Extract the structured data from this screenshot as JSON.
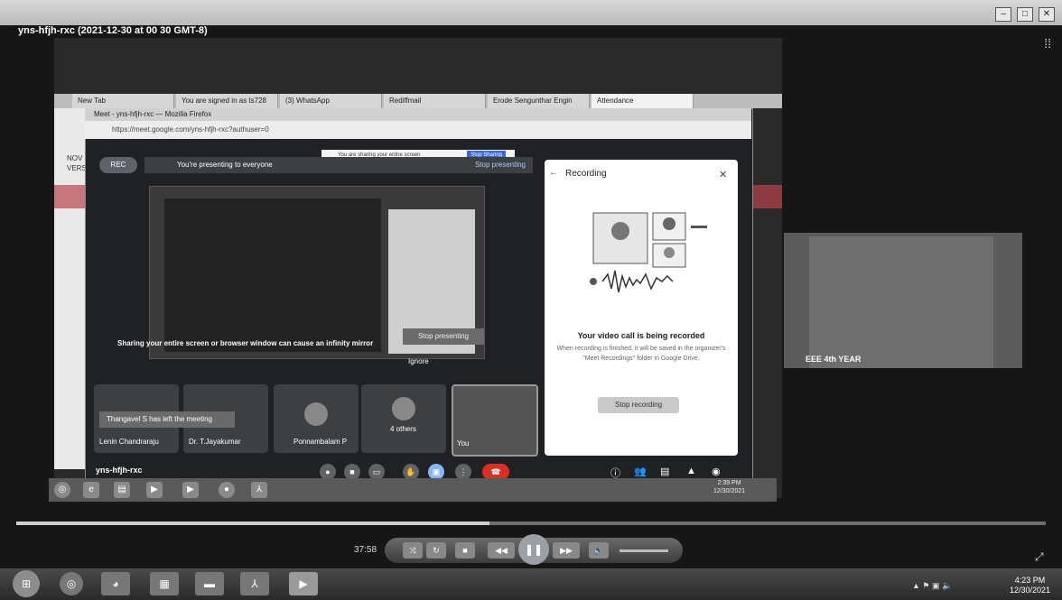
{
  "player": {
    "video_title": "yns-hfjh-rxc (2021-12-30 at 00 30 GMT-8)",
    "elapsed": "37:58",
    "progress_fraction": 0.46
  },
  "browser": {
    "tabs": [
      "New Tab",
      "You are signed in as ts728",
      "(3) WhatsApp",
      "Rediffmail",
      "Erode Sengunthar Engin",
      "Attendance"
    ],
    "window_title": "Meet - yns-hfjh-rxc — Mozilla Firefox",
    "url": "https://meet.google.com/yns-hfjh-rxc?authuser=0",
    "left_strip_text": "NOV VERS"
  },
  "share_bar": {
    "text": "You are sharing your entire screen",
    "button": "Stop Sharing"
  },
  "meet": {
    "rec_label": "REC",
    "presenting_text": "You're presenting to everyone",
    "stop_presenting": "Stop presenting",
    "inner_stop_presenting": "Stop presenting",
    "mirror_warning": "Sharing your entire screen or browser window can cause an infinity mirror",
    "ignore": "Ignore",
    "left_meeting_toast": "Thangavel S has left the meeting",
    "participants": [
      "Lenin Chandraraju",
      "Dr. T.Jayakumar",
      "Ponnambalam P",
      "4 others",
      "You"
    ],
    "meeting_code": "yns-hfjh-rxc"
  },
  "recording_panel": {
    "title": "Recording",
    "headline": "Your video call is being recorded",
    "description": "When recording is finished, it will be saved in the organizer's \"Meet Recordings\" folder in Google Drive.",
    "stop_button": "Stop recording"
  },
  "inner_clock": {
    "time": "2:39 PM",
    "date": "12/30/2021"
  },
  "webcam": {
    "label": "EEE 4th YEAR"
  },
  "taskbar_clock": {
    "time": "4:23 PM",
    "date": "12/30/2021"
  },
  "icons": [
    "close-icon",
    "back-arrow-icon",
    "mic-icon",
    "camera-icon",
    "captions-icon",
    "hand-icon",
    "present-icon",
    "more-icon",
    "hangup-icon",
    "info-icon",
    "people-icon",
    "chat-icon",
    "activities-icon",
    "shield-icon",
    "shuffle-icon",
    "repeat-icon",
    "stop-icon",
    "prev-icon",
    "play-pause-icon",
    "next-icon",
    "volume-icon",
    "fullscreen-icon"
  ]
}
